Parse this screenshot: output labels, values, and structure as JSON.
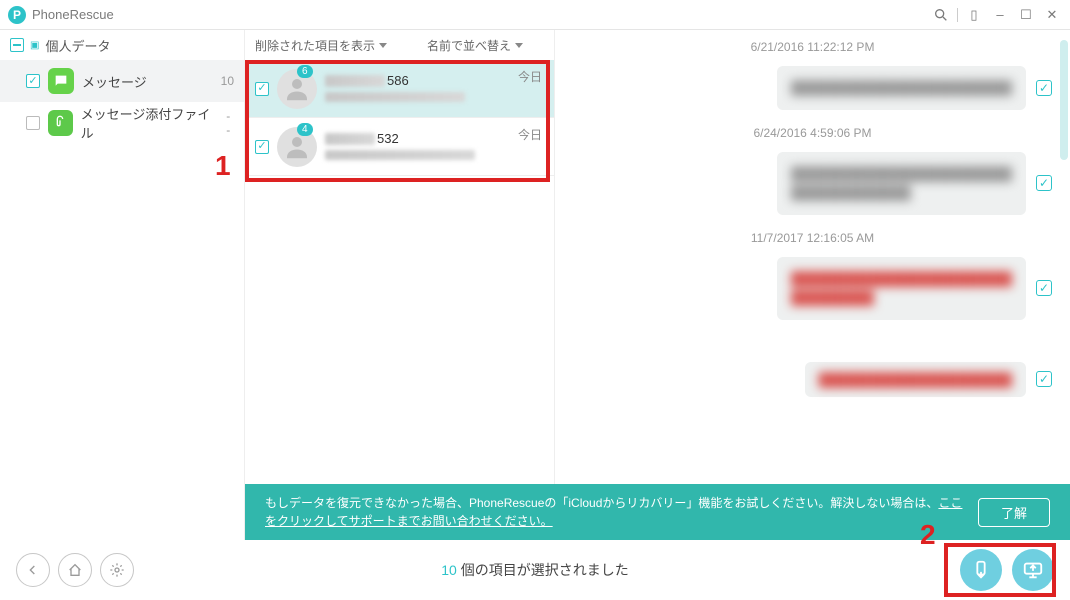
{
  "app": {
    "title": "PhoneRescue",
    "logo_letter": "P"
  },
  "window": {
    "search_icon": "search-icon",
    "min": "–",
    "max": "☐",
    "close": "✕"
  },
  "sidebar": {
    "group_label": "個人データ",
    "items": [
      {
        "icon": "messages",
        "label": "メッセージ",
        "count": "10",
        "checked": true,
        "selected": true
      },
      {
        "icon": "attachments",
        "label": "メッセージ添付ファイル",
        "count": "--",
        "checked": false,
        "selected": false
      }
    ]
  },
  "mid_header": {
    "filter_label": "削除された項目を表示",
    "sort_label": "名前で並べ替え"
  },
  "conversations": {
    "callout_number": "1",
    "items": [
      {
        "badge": "6",
        "title_suffix": "586",
        "date": "今日",
        "checked": true,
        "active": true
      },
      {
        "badge": "4",
        "title_suffix": "532",
        "date": "今日",
        "checked": true,
        "active": false
      }
    ]
  },
  "messages": {
    "threads": [
      {
        "timestamp": "6/21/2016 11:22:12 PM",
        "tone": "normal"
      },
      {
        "timestamp": "6/24/2016 4:59:06 PM",
        "tone": "normal"
      },
      {
        "timestamp": "11/7/2017 12:16:05 AM",
        "tone": "red"
      }
    ],
    "extra_tone": "red"
  },
  "banner": {
    "text_prefix": "もしデータを復元できなかった場合、PhoneRescueの「iCloudからリカバリー」機能をお試しください。解決しない場合は、",
    "link_text": "ここをクリックしてサポートまでお問い合わせください。",
    "ok_label": "了解",
    "callout_number": "2"
  },
  "footer": {
    "count_number": "10",
    "status_suffix": " 個の項目が選択されました"
  }
}
